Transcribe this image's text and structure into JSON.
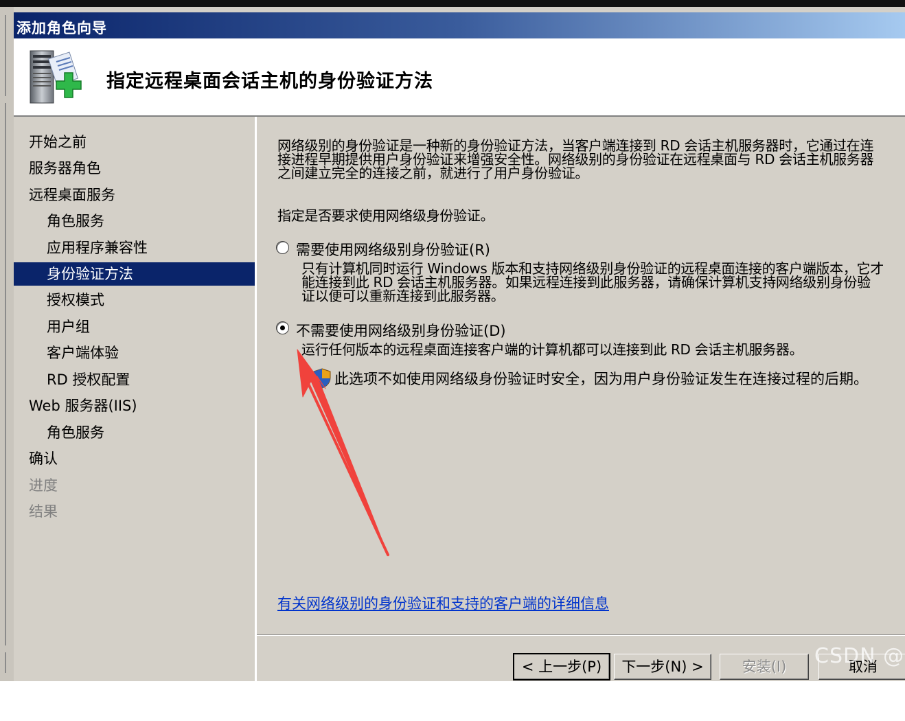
{
  "window": {
    "title": "添加角色向导",
    "page_title": "指定远程桌面会话主机的身份验证方法"
  },
  "nav": {
    "items": [
      {
        "label": "开始之前",
        "level": 1,
        "state": "normal"
      },
      {
        "label": "服务器角色",
        "level": 1,
        "state": "normal"
      },
      {
        "label": "远程桌面服务",
        "level": 1,
        "state": "normal"
      },
      {
        "label": "角色服务",
        "level": 2,
        "state": "normal"
      },
      {
        "label": "应用程序兼容性",
        "level": 2,
        "state": "normal"
      },
      {
        "label": "身份验证方法",
        "level": 2,
        "state": "selected"
      },
      {
        "label": "授权模式",
        "level": 2,
        "state": "normal"
      },
      {
        "label": "用户组",
        "level": 2,
        "state": "normal"
      },
      {
        "label": "客户端体验",
        "level": 2,
        "state": "normal"
      },
      {
        "label": "RD 授权配置",
        "level": 2,
        "state": "normal"
      },
      {
        "label": "Web 服务器(IIS)",
        "level": 1,
        "state": "normal"
      },
      {
        "label": "角色服务",
        "level": 2,
        "state": "normal"
      },
      {
        "label": "确认",
        "level": 1,
        "state": "normal"
      },
      {
        "label": "进度",
        "level": 1,
        "state": "disabled"
      },
      {
        "label": "结果",
        "level": 1,
        "state": "disabled"
      }
    ]
  },
  "content": {
    "intro_lines": [
      "网络级别的身份验证是一种新的身份验证方法，当客户端连接到 RD 会话主机服务器时，它通过在连",
      "接进程早期提供用户身份验证来增强安全性。网络级别的身份验证在远程桌面与 RD 会话主机服务器",
      "之间建立完全的连接之前，就进行了用户身份验证。"
    ],
    "prompt": "指定是否要求使用网络级身份验证。",
    "option_require": {
      "label": "需要使用网络级别身份验证(R)",
      "selected": false,
      "desc_lines": [
        "只有计算机同时运行 Windows 版本和支持网络级别身份验证的远程桌面连接的客户端版本，它才",
        "能连接到此 RD 会话主机服务器。如果远程连接到此服务器，请确保计算机支持网络级别身份验",
        "证以便可以重新连接到此服务器。"
      ]
    },
    "option_norequire": {
      "label": "不需要使用网络级别身份验证(D)",
      "selected": true,
      "desc": "运行任何版本的远程桌面连接客户端的计算机都可以连接到此 RD 会话主机服务器。",
      "warning": "此选项不如使用网络级身份验证时安全，因为用户身份验证发生在连接过程的后期。"
    },
    "help_link": "有关网络级别的身份验证和支持的客户端的详细信息"
  },
  "buttons": {
    "prev": "< 上一步(P)",
    "next": "下一步(N) >",
    "install": "安装(I)",
    "cancel": "取消"
  },
  "watermark": "CSDN @",
  "colors": {
    "title_bar_start": "#0a246a",
    "title_bar_end": "#a6caf0",
    "selection": "#0a246a",
    "link": "#0033cc",
    "annotation_arrow": "#f0423c"
  }
}
